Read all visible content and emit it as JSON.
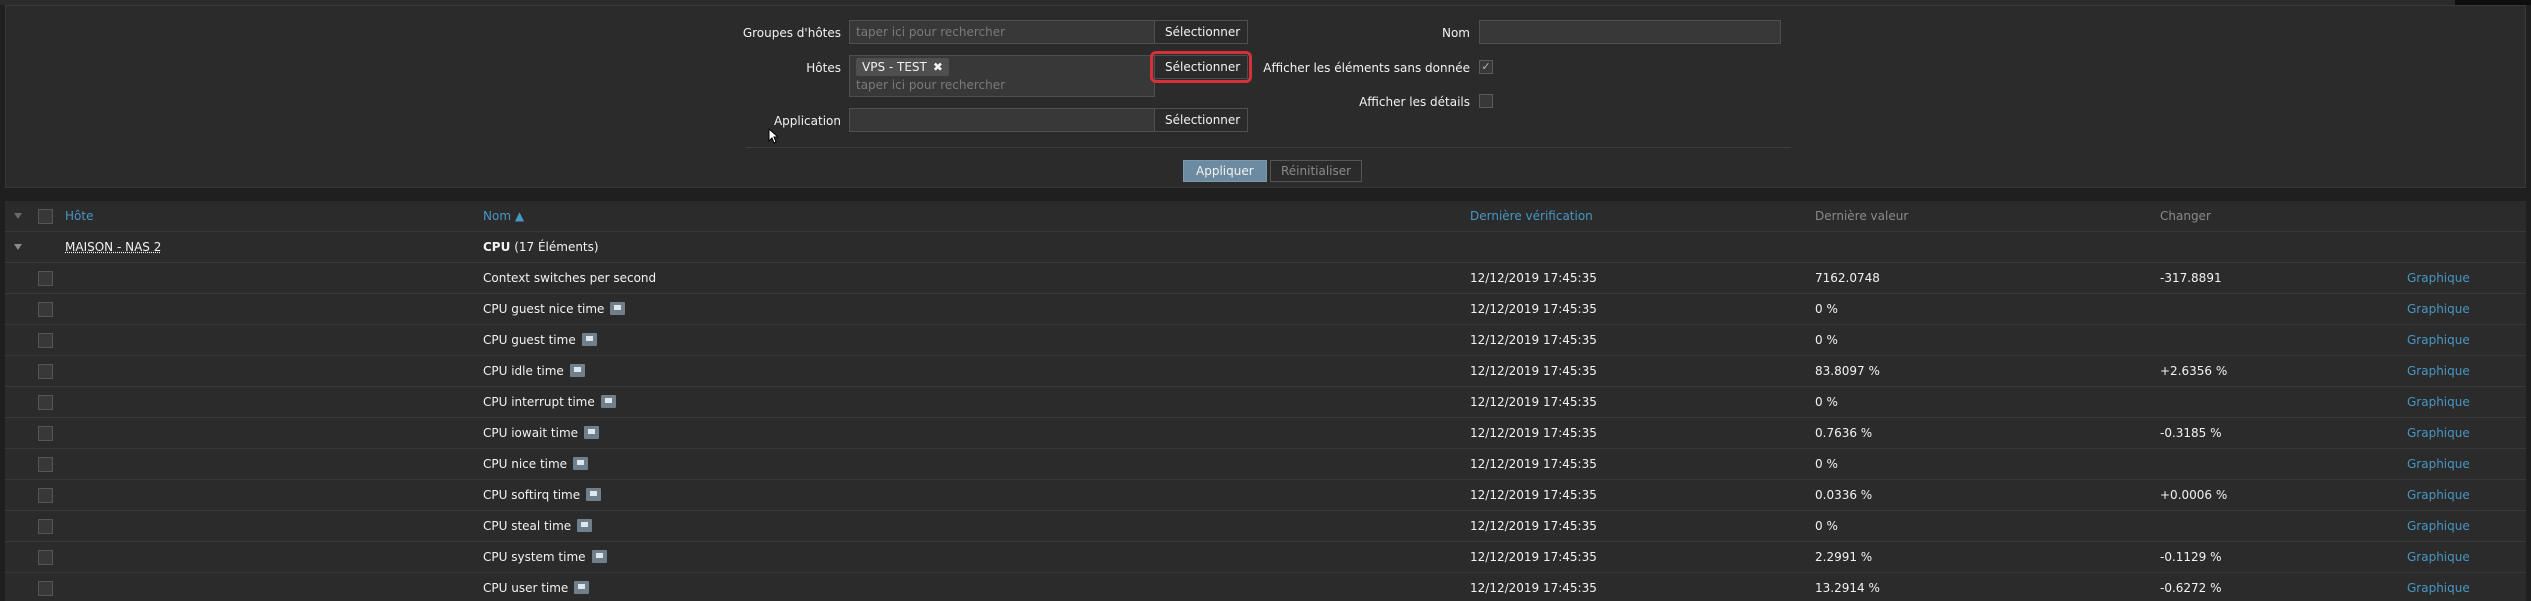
{
  "filter": {
    "host_groups_label": "Groupes d'hôtes",
    "host_groups_placeholder": "taper ici pour rechercher",
    "hosts_label": "Hôtes",
    "hosts_tag": "VPS - TEST",
    "hosts_placeholder": "taper ici pour rechercher",
    "application_label": "Application",
    "application_value": "",
    "select_label": "Sélectionner",
    "name_label": "Nom",
    "name_value": "",
    "show_without_data_label": "Afficher les éléments sans donnée",
    "show_without_data_checked": true,
    "show_details_label": "Afficher les détails",
    "show_details_checked": false,
    "apply_label": "Appliquer",
    "reset_label": "Réinitialiser"
  },
  "table": {
    "headers": {
      "host": "Hôte",
      "name": "Nom ▲",
      "last_check": "Dernière vérification",
      "last_value": "Dernière valeur",
      "change": "Changer"
    },
    "group": {
      "host": "MAISON - NAS 2",
      "app": "CPU",
      "count": "(17 Éléments)"
    },
    "rows": [
      {
        "name": "Context switches per second",
        "flag": false,
        "time": "12/12/2019 17:45:35",
        "value": "7162.0748",
        "change": "-317.8891",
        "action": "Graphique"
      },
      {
        "name": "CPU guest nice time",
        "flag": true,
        "time": "12/12/2019 17:45:35",
        "value": "0 %",
        "change": "",
        "action": "Graphique"
      },
      {
        "name": "CPU guest time",
        "flag": true,
        "time": "12/12/2019 17:45:35",
        "value": "0 %",
        "change": "",
        "action": "Graphique"
      },
      {
        "name": "CPU idle time",
        "flag": true,
        "time": "12/12/2019 17:45:35",
        "value": "83.8097 %",
        "change": "+2.6356 %",
        "action": "Graphique"
      },
      {
        "name": "CPU interrupt time",
        "flag": true,
        "time": "12/12/2019 17:45:35",
        "value": "0 %",
        "change": "",
        "action": "Graphique"
      },
      {
        "name": "CPU iowait time",
        "flag": true,
        "time": "12/12/2019 17:45:35",
        "value": "0.7636 %",
        "change": "-0.3185 %",
        "action": "Graphique"
      },
      {
        "name": "CPU nice time",
        "flag": true,
        "time": "12/12/2019 17:45:35",
        "value": "0 %",
        "change": "",
        "action": "Graphique"
      },
      {
        "name": "CPU softirq time",
        "flag": true,
        "time": "12/12/2019 17:45:35",
        "value": "0.0336 %",
        "change": "+0.0006 %",
        "action": "Graphique"
      },
      {
        "name": "CPU steal time",
        "flag": true,
        "time": "12/12/2019 17:45:35",
        "value": "0 %",
        "change": "",
        "action": "Graphique"
      },
      {
        "name": "CPU system time",
        "flag": true,
        "time": "12/12/2019 17:45:35",
        "value": "2.2991 %",
        "change": "-0.1129 %",
        "action": "Graphique"
      },
      {
        "name": "CPU user time",
        "flag": true,
        "time": "12/12/2019 17:45:35",
        "value": "13.2914 %",
        "change": "-0.6272 %",
        "action": "Graphique"
      }
    ]
  },
  "colors": {
    "link": "#4796c4",
    "highlight": "#d6313a",
    "apply": "#6c8aa0"
  },
  "icons": {
    "tag_remove": "close-icon",
    "item_info": "flag-icon",
    "sort": "sort-ascending-icon",
    "expand": "triangle-down-icon",
    "pointer": "mouse-cursor-icon"
  }
}
